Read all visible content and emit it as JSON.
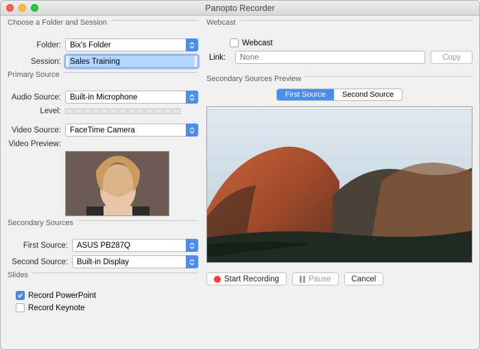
{
  "window": {
    "title": "Panopto Recorder"
  },
  "folderSession": {
    "legend": "Choose a Folder and Session",
    "folder_label": "Folder:",
    "folder_value": "Bix's Folder",
    "session_label": "Session:",
    "session_value": "Sales Training"
  },
  "primary": {
    "legend": "Primary Source",
    "audio_label": "Audio Source:",
    "audio_value": "Built-in Microphone",
    "level_label": "Level:",
    "video_label": "Video Source:",
    "video_value": "FaceTime Camera",
    "preview_label": "Video Preview:"
  },
  "secondary": {
    "legend": "Secondary Sources",
    "first_label": "First Source:",
    "first_value": "ASUS PB287Q",
    "second_label": "Second Source:",
    "second_value": "Built-in Display"
  },
  "slides": {
    "legend": "Slides",
    "record_ppt": "Record PowerPoint",
    "record_keynote": "Record Keynote",
    "ppt_checked": true,
    "keynote_checked": false
  },
  "webcast": {
    "legend": "Webcast",
    "checkbox_label": "Webcast",
    "link_label": "Link:",
    "link_placeholder": "None",
    "copy_label": "Copy"
  },
  "preview_panel": {
    "legend": "Secondary Sources Preview",
    "tab_first": "First Source",
    "tab_second": "Second Source"
  },
  "buttons": {
    "start": "Start Recording",
    "pause": "Pause",
    "cancel": "Cancel"
  }
}
